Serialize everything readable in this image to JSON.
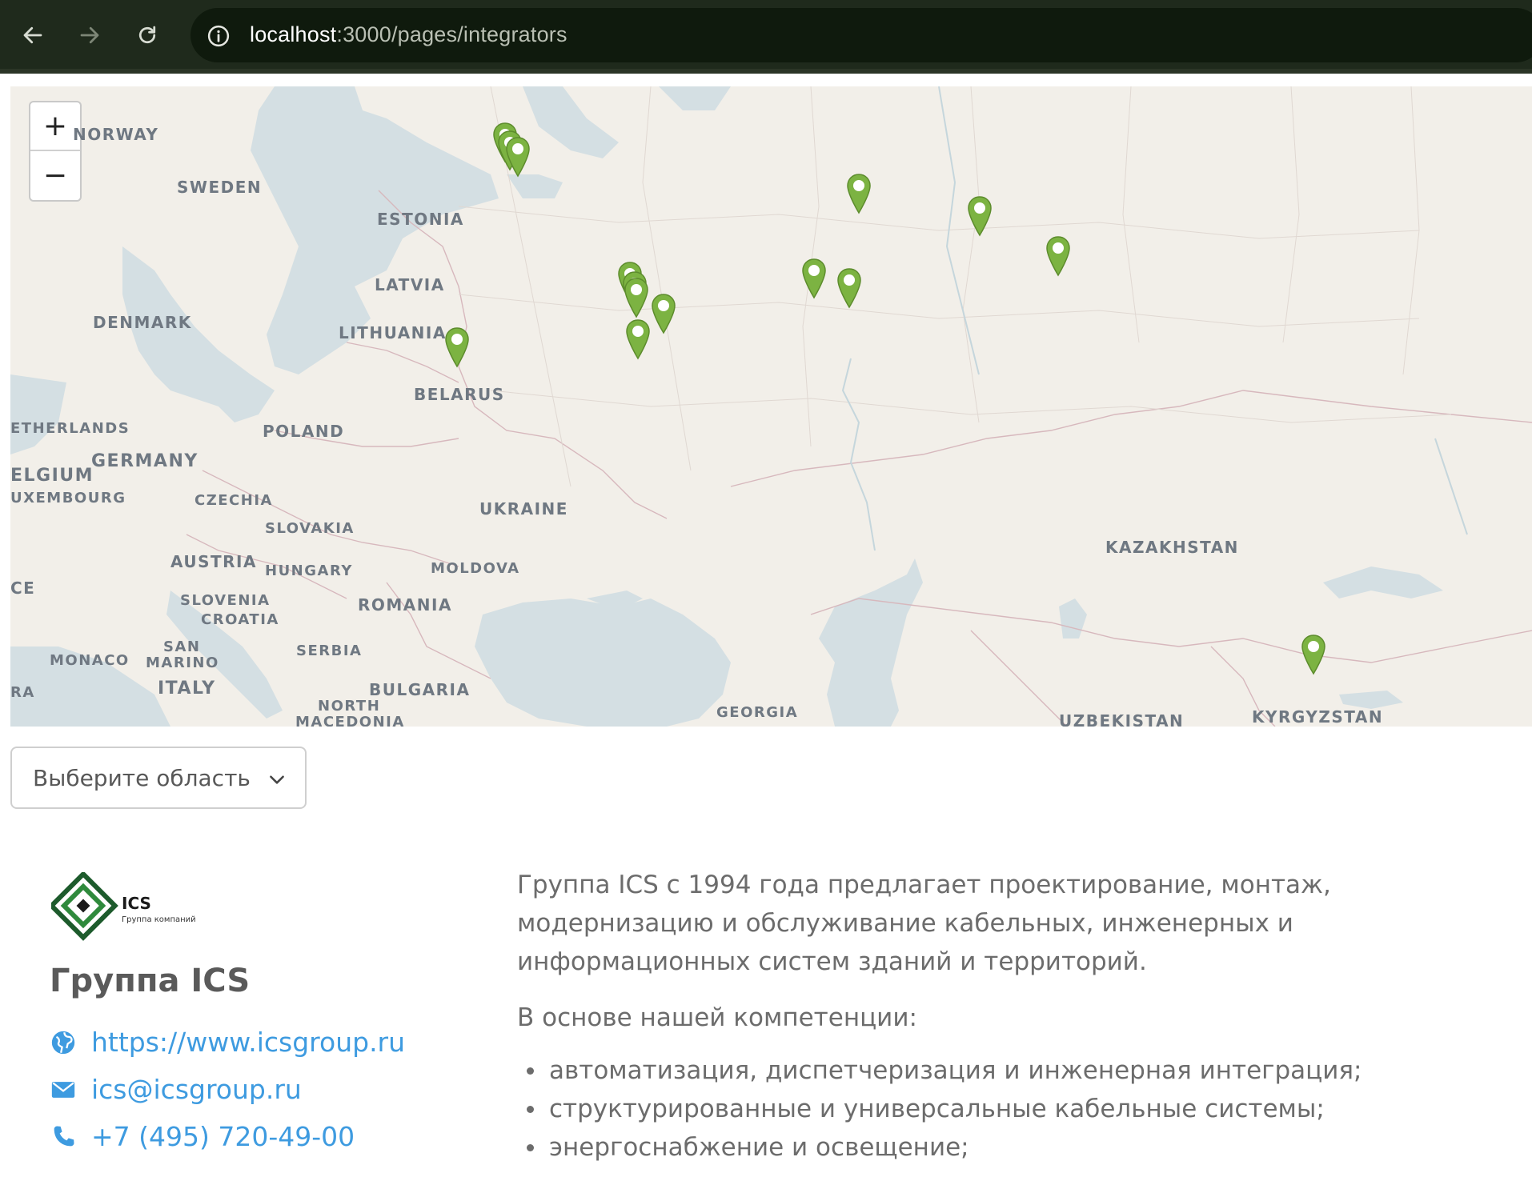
{
  "browser": {
    "back_icon": "arrow-left-icon",
    "forward_icon": "arrow-right-icon",
    "reload_icon": "reload-icon",
    "info_icon": "info-icon",
    "url_host": "localhost",
    "url_path": ":3000/pages/integrators"
  },
  "map": {
    "zoom_in_label": "+",
    "zoom_out_label": "−",
    "labels": {
      "norway": "NORWAY",
      "sweden": "SWEDEN",
      "estonia": "ESTONIA",
      "latvia": "LATVIA",
      "denmark": "DENMARK",
      "lithuania": "LITHUANIA",
      "belarus": "BELARUS",
      "netherlands": "ETHERLANDS",
      "poland": "POLAND",
      "germany": "GERMANY",
      "belgium": "ELGIUM",
      "luxembourg": "UXEMBOURG",
      "czechia": "CZECHIA",
      "ukraine": "UKRAINE",
      "slovakia": "SLOVAKIA",
      "austria": "AUSTRIA",
      "hungary": "HUNGARY",
      "moldova": "MOLDOVA",
      "france": "CE",
      "slovenia": "SLOVENIA",
      "croatia": "CROATIA",
      "romania": "ROMANIA",
      "san": "SAN",
      "marino": "MARINO",
      "monaco": "MONACO",
      "serbia": "SERBIA",
      "ra": "RA",
      "italy": "ITALY",
      "bulgaria": "BULGARIA",
      "north": "NORTH",
      "macedonia": "MACEDONIA",
      "georgia": "GEORGIA",
      "kazakhstan": "KAZAKHSTAN",
      "uzbekistan": "UZBEKISTAN",
      "kyrgyzstan": "KYRGYZSTAN"
    },
    "marker_color": "#7cb342",
    "marker_count": 16
  },
  "region_select": {
    "placeholder": "Выберите область",
    "chevron_icon": "chevron-down-icon"
  },
  "company": {
    "logo_text": "ICS",
    "logo_subtitle": "Группа компаний",
    "name": "Группа ICS",
    "website": "https://www.icsgroup.ru",
    "email": "ics@icsgroup.ru",
    "phone": "+7 (495) 720-49-00",
    "website_icon": "globe-icon",
    "email_icon": "envelope-icon",
    "phone_icon": "phone-icon",
    "link_color": "#3e9be0"
  },
  "description": {
    "intro": "Группа ICS с 1994 года предлагает проектирование, монтаж, модернизацию и обслуживание кабельных, инженерных и информационных систем зданий и территорий.",
    "competence_heading": "В основе нашей компетенции:",
    "competencies": [
      "автоматизация, диспетчеризация и инженерная интеграция;",
      "структурированные и универсальные кабельные системы;",
      "энергоснабжение и освещение;"
    ]
  }
}
